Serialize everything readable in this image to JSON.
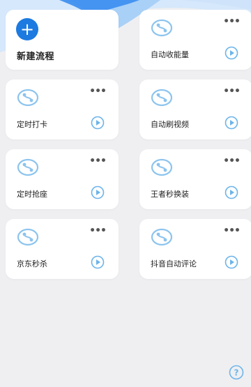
{
  "new_flow": {
    "icon": "plus-icon",
    "label": "新建流程"
  },
  "flows": [
    {
      "label": "自动收能量"
    },
    {
      "label": "定时打卡"
    },
    {
      "label": "自动刷视频"
    },
    {
      "label": "定时抢座"
    },
    {
      "label": "王者秒换装"
    },
    {
      "label": "京东秒杀"
    },
    {
      "label": "抖音自动评论"
    }
  ],
  "icons": {
    "flow": "flow-icon",
    "more": "more-icon",
    "play": "play-icon",
    "help": "help-icon"
  },
  "colors": {
    "accent": "#1c7ae0",
    "wave_light": "#d6e8fb",
    "wave_mid": "#a9d0f7",
    "wave_dark": "#3a8df0",
    "icon_line": "#8cc4ee",
    "background": "#efeff2"
  }
}
